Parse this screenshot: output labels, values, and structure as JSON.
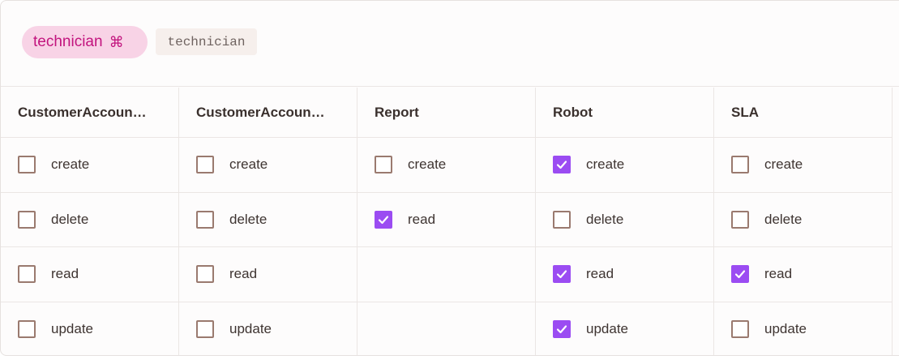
{
  "role": {
    "name": "technician",
    "shortcut_glyph": "⌘",
    "code": "technician"
  },
  "columns": [
    {
      "header": "CustomerAccoun…",
      "perms": [
        {
          "label": "create",
          "checked": false
        },
        {
          "label": "delete",
          "checked": false
        },
        {
          "label": "read",
          "checked": false
        },
        {
          "label": "update",
          "checked": false
        }
      ]
    },
    {
      "header": "CustomerAccoun…",
      "perms": [
        {
          "label": "create",
          "checked": false
        },
        {
          "label": "delete",
          "checked": false
        },
        {
          "label": "read",
          "checked": false
        },
        {
          "label": "update",
          "checked": false
        }
      ]
    },
    {
      "header": "Report",
      "perms": [
        {
          "label": "create",
          "checked": false
        },
        {
          "label": "read",
          "checked": true
        }
      ]
    },
    {
      "header": "Robot",
      "perms": [
        {
          "label": "create",
          "checked": true
        },
        {
          "label": "delete",
          "checked": false
        },
        {
          "label": "read",
          "checked": true
        },
        {
          "label": "update",
          "checked": true
        }
      ]
    },
    {
      "header": "SLA",
      "perms": [
        {
          "label": "create",
          "checked": false
        },
        {
          "label": "delete",
          "checked": false
        },
        {
          "label": "read",
          "checked": true
        },
        {
          "label": "update",
          "checked": false
        }
      ]
    }
  ],
  "colors": {
    "accent": "#9b4cf2",
    "role_pill_bg": "#f8d3e6",
    "role_pill_text": "#c2147e",
    "checkbox_border": "#9a7a6f"
  }
}
